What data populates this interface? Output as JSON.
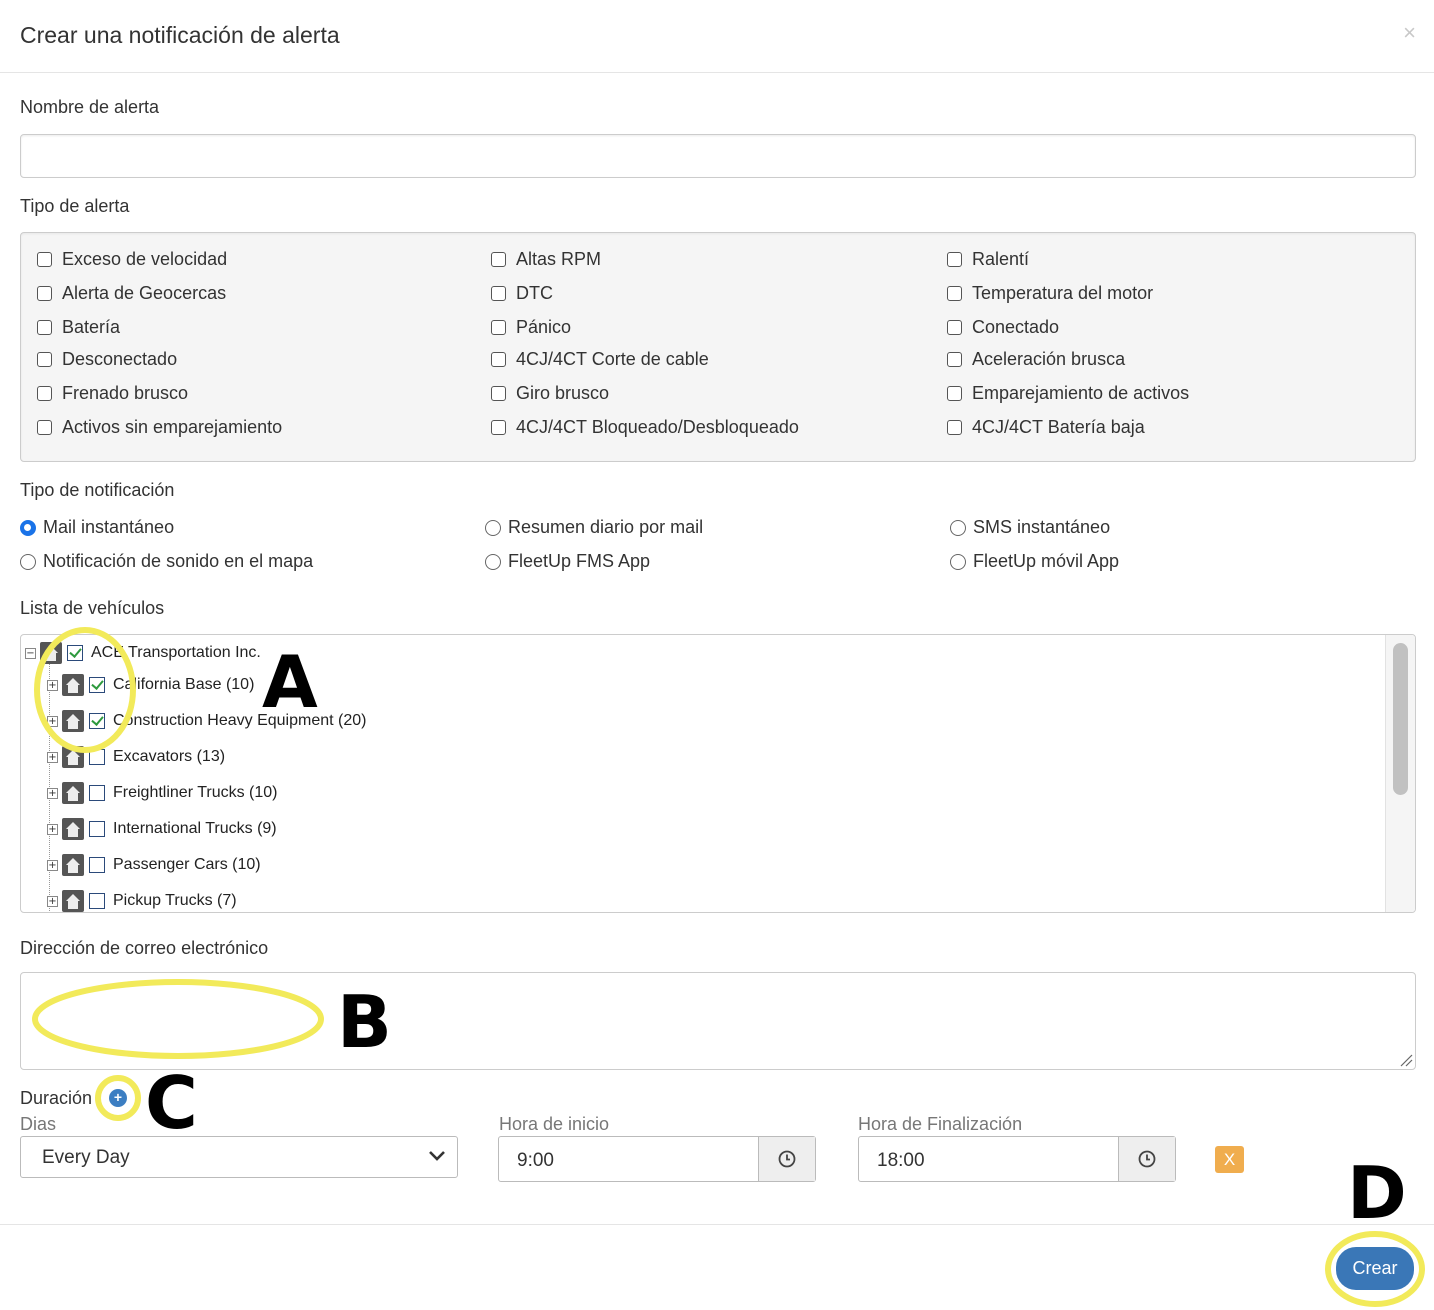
{
  "header": {
    "title": "Crear una notificación de alerta",
    "close_label": "×"
  },
  "alert_name": {
    "label": "Nombre de alerta",
    "value": "",
    "placeholder": ""
  },
  "alert_type": {
    "label": "Tipo de alerta",
    "options": [
      "Exceso de velocidad",
      "Altas RPM",
      "Ralentí",
      "Alerta de Geocercas",
      "DTC",
      "Temperatura del motor",
      "Batería",
      "Pánico",
      "Conectado",
      "Desconectado",
      "4CJ/4CT Corte de cable",
      "Aceleración brusca",
      "Frenado brusco",
      "Giro brusco",
      "Emparejamiento de activos",
      "Activos sin emparejamiento",
      "4CJ/4CT Bloqueado/Desbloqueado",
      "4CJ/4CT Batería baja"
    ]
  },
  "notification_type": {
    "label": "Tipo de notificación",
    "options": [
      "Mail instantáneo",
      "Resumen diario por mail",
      "SMS instantáneo",
      "Notificación de sonido en el mapa",
      "FleetUp FMS App",
      "FleetUp móvil App"
    ],
    "selected": "Mail instantáneo"
  },
  "vehicle_list": {
    "label": "Lista de vehículos",
    "root": {
      "label": "ACE Transportation Inc.",
      "checked": true,
      "expander": "−"
    },
    "groups": [
      {
        "label": "California Base (10)",
        "checked": true
      },
      {
        "label": "Construction Heavy Equipment (20)",
        "checked": true
      },
      {
        "label": "Excavators (13)",
        "checked": false
      },
      {
        "label": "Freightliner Trucks (10)",
        "checked": false
      },
      {
        "label": "International Trucks (9)",
        "checked": false
      },
      {
        "label": "Passenger Cars (10)",
        "checked": false
      },
      {
        "label": "Pickup Trucks (7)",
        "checked": false
      }
    ],
    "group_expander": "+"
  },
  "email": {
    "label": "Dirección de correo electrónico",
    "value": ""
  },
  "duration": {
    "label": "Duración",
    "add_icon": "plus-circle-icon",
    "days_label": "Dias",
    "days_value": "Every Day",
    "start_label": "Hora de inicio",
    "start_value": "9:00",
    "end_label": "Hora de Finalización",
    "end_value": "18:00",
    "remove_label": "X"
  },
  "footer": {
    "create_label": "Crear"
  },
  "annotations": {
    "a": "A",
    "b": "B",
    "c": "C",
    "d": "D"
  },
  "colors": {
    "primary": "#3a77b7",
    "warning": "#f0ad4e",
    "highlight": "#f2ea5a",
    "radio_selected": "#1a73e8"
  }
}
